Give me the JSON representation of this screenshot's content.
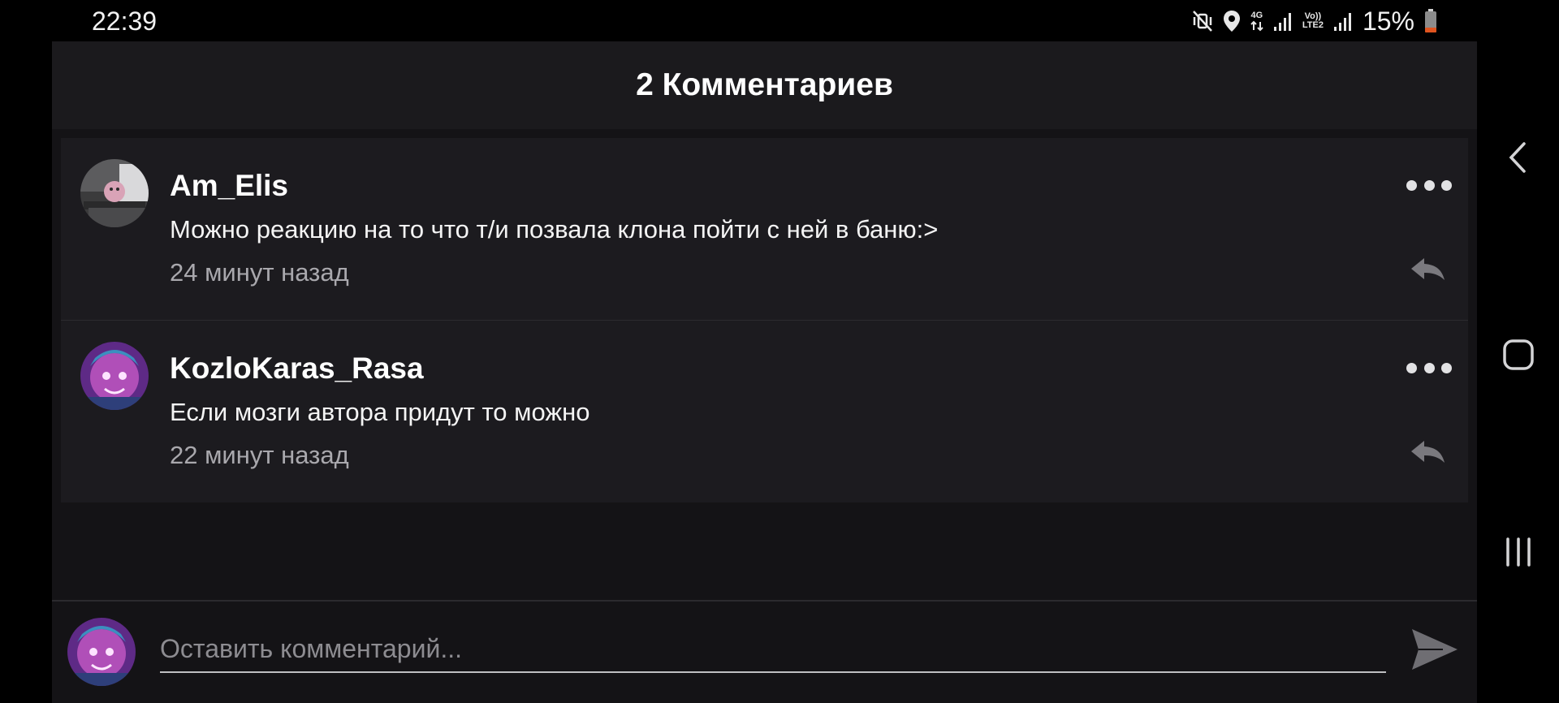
{
  "status_bar": {
    "time": "22:39",
    "network_4g": "4G",
    "volte_top": "Vo))",
    "volte_bottom": "LTE2",
    "battery_percent": "15%",
    "icons": [
      "mute-vibrate-icon",
      "location-icon",
      "4g-data-icon",
      "signal-icon",
      "volte-icon",
      "signal-icon",
      "battery-low-icon"
    ]
  },
  "header": {
    "title": "2 Комментариев"
  },
  "comments": [
    {
      "author": "Am_Elis",
      "text": "Можно реакцию на то что т/и позвала клона пойти с ней в баню:>",
      "time": "24 минут назад"
    },
    {
      "author": "KozloKaras_Rasa",
      "text": "Если мозги автора придут то можно",
      "time": "22 минут назад"
    }
  ],
  "composer": {
    "placeholder": "Оставить комментарий..."
  },
  "colors": {
    "panel": "#141316",
    "header": "#1b1a1d",
    "card": "#1c1b1f",
    "muted_text": "#a9a8ad",
    "accent_icon": "#7a797e"
  },
  "nav_bar": {
    "icons": [
      "back-icon",
      "home-icon",
      "recents-icon"
    ]
  }
}
